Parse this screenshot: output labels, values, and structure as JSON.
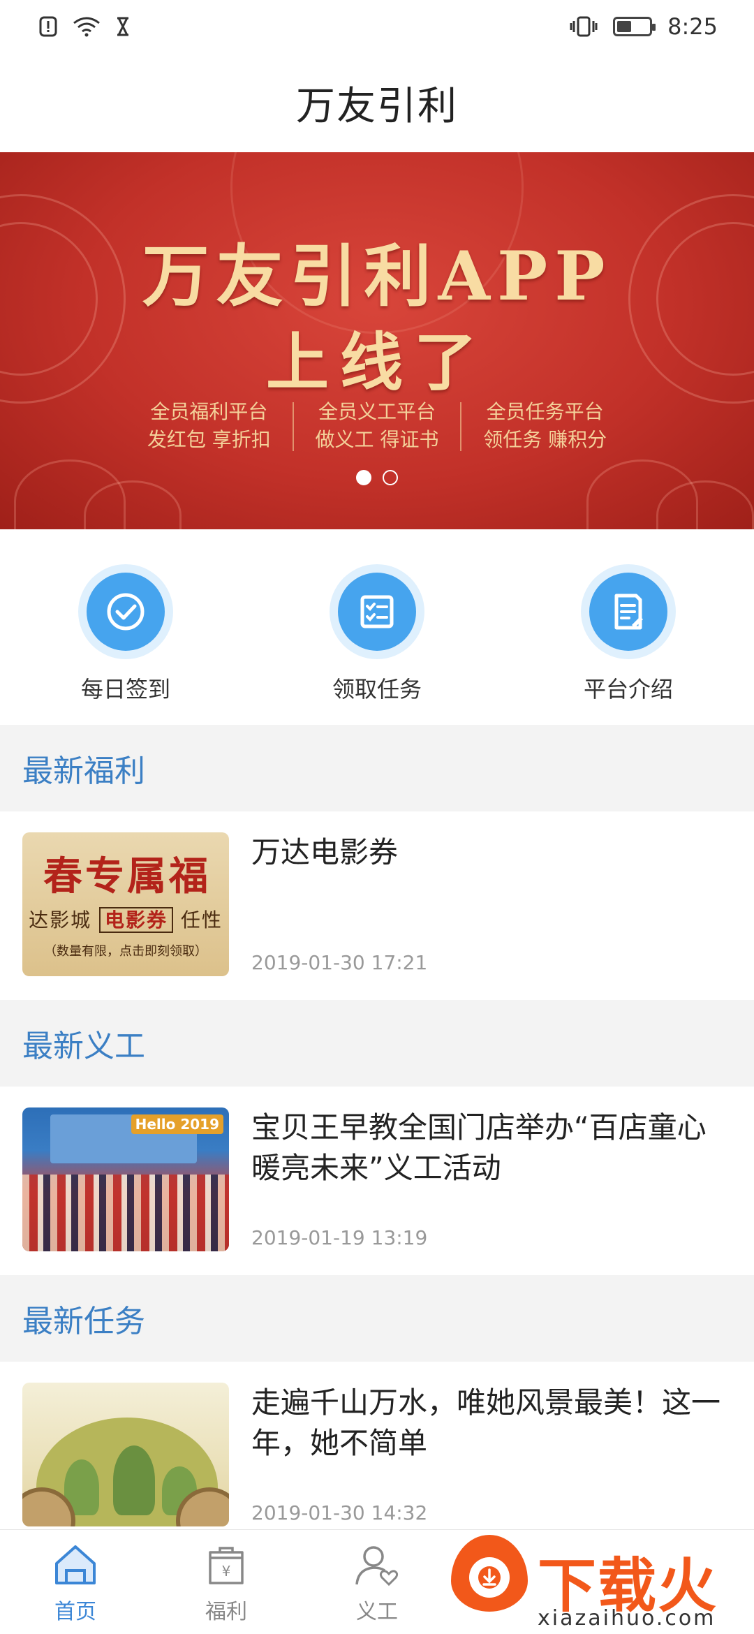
{
  "status_bar": {
    "time": "8:25",
    "icons": [
      "alert-icon",
      "wifi-icon",
      "hourglass-icon",
      "vibrate-icon",
      "battery-icon"
    ]
  },
  "header": {
    "title": "万友引利"
  },
  "banner": {
    "headline_1": "万友引利APP",
    "headline_2": "上线了",
    "features": [
      {
        "line1": "全员福利平台",
        "line2": "发红包 享折扣"
      },
      {
        "line1": "全员义工平台",
        "line2": "做义工 得证书"
      },
      {
        "line1": "全员任务平台",
        "line2": "领任务 赚积分"
      }
    ],
    "active_page": 1,
    "page_count": 2
  },
  "quick_actions": [
    {
      "label": "每日签到",
      "icon": "check-circle-icon"
    },
    {
      "label": "领取任务",
      "icon": "task-list-icon"
    },
    {
      "label": "平台介绍",
      "icon": "document-edit-icon"
    }
  ],
  "sections": {
    "welfare": {
      "heading": "最新福利",
      "item": {
        "title": "万达电影券",
        "date": "2019-01-30 17:21",
        "thumb": {
          "big": "春专属福",
          "mid_pre": "达影城",
          "mid_box": "电影券",
          "mid_post": "任性",
          "small": "（数量有限，点击即刻领取）"
        }
      }
    },
    "volunteer": {
      "heading": "最新义工",
      "item": {
        "title": "宝贝王早教全国门店举办“百店童心 暖亮未来”义工活动",
        "date": "2019-01-19 13:19",
        "thumb_tag": "Hello 2019"
      }
    },
    "task": {
      "heading": "最新任务",
      "item": {
        "title": "走遍千山万水，唯她风景最美！这一年，她不简单",
        "date": "2019-01-30 14:32"
      }
    }
  },
  "tab_bar": {
    "tabs": [
      {
        "label": "首页",
        "icon": "home-icon",
        "active": true
      },
      {
        "label": "福利",
        "icon": "welfare-bag-icon",
        "active": false
      },
      {
        "label": "义工",
        "icon": "volunteer-heart-icon",
        "active": false
      }
    ]
  },
  "watermark": {
    "brand": "下载火",
    "url": "xiazaihuo.com"
  },
  "colors": {
    "accent_blue": "#3b86d6",
    "section_heading": "#3b7fc4",
    "banner_red": "#c23129",
    "banner_gold": "#f8dca3",
    "watermark_orange": "#f2581a"
  }
}
